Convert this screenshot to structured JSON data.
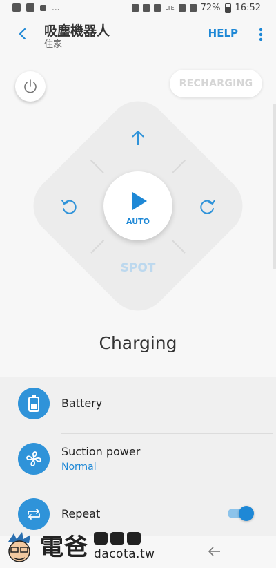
{
  "status_bar": {
    "more_indicator": "...",
    "network": "LTE",
    "battery": "72%",
    "time": "16:52"
  },
  "header": {
    "title": "吸塵機器人",
    "subtitle": "住家",
    "help_label": "HELP"
  },
  "controls": {
    "recharging_label": "RECHARGING",
    "auto_label": "AUTO",
    "spot_label": "SPOT",
    "status_text": "Charging"
  },
  "settings": {
    "items": [
      {
        "label": "Battery",
        "icon": "battery-icon"
      },
      {
        "label": "Suction power",
        "value": "Normal",
        "icon": "fan-icon"
      },
      {
        "label": "Repeat",
        "icon": "repeat-icon",
        "toggle_on": true
      }
    ]
  },
  "watermark": {
    "brand": "電爸",
    "site": "dacota.tw"
  },
  "colors": {
    "accent": "#1e88d6",
    "icon_bg": "#2f93d9",
    "pad_bg": "#ececec"
  }
}
